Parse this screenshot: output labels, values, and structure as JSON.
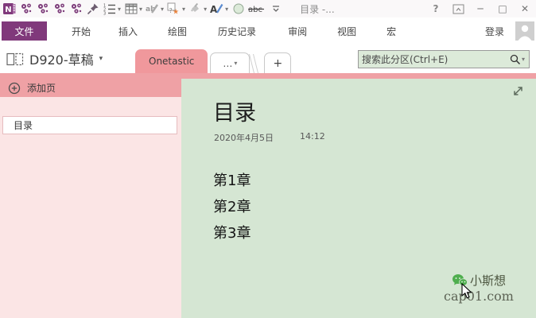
{
  "titlebar": {
    "title": "目录 -...",
    "help": "?",
    "spelling_letters": "ab",
    "strikethrough_label": "abc",
    "minimize": "─",
    "maximize": "□",
    "close": "✕",
    "quick_access_icons": [
      "onenote-logo",
      "macro-1",
      "macro-2",
      "macro-3",
      "macro-4",
      "pin",
      "numbered-list",
      "table",
      "spelling",
      "tag-star",
      "paint-bucket",
      "font-color",
      "green-circle",
      "strikethrough",
      "customize-toolbar"
    ]
  },
  "ribbon": {
    "tabs": [
      {
        "label": "文件",
        "active": true
      },
      {
        "label": "开始",
        "active": false
      },
      {
        "label": "插入",
        "active": false
      },
      {
        "label": "绘图",
        "active": false
      },
      {
        "label": "历史记录",
        "active": false
      },
      {
        "label": "审阅",
        "active": false
      },
      {
        "label": "视图",
        "active": false
      },
      {
        "label": "宏",
        "active": false
      }
    ],
    "sign_in_label": "登录"
  },
  "nav": {
    "notebook_label": "D920-草稿",
    "notebook_caret": "▾",
    "section_tabs": [
      {
        "label": "Onetastic",
        "active": true
      },
      {
        "label": "…",
        "active": false
      }
    ],
    "section_dots_caret": "▾",
    "new_section_label": "+",
    "search_placeholder": "搜索此分区(Ctrl+E)",
    "search_caret": "▾"
  },
  "sidebar": {
    "add_page_label": "添加页",
    "pages": [
      {
        "title": "目录",
        "selected": true
      }
    ]
  },
  "page": {
    "title": "目录",
    "date": "2020年4月5日",
    "time": "14:12",
    "lines": [
      "第1章",
      "第2章",
      "第3章"
    ]
  },
  "watermark": {
    "name": "小斯想",
    "site": "cap01.com"
  },
  "colors": {
    "accent_purple": "#80397B",
    "section_tab_pink": "#F0989C",
    "strip_pink": "#EFA1A5",
    "sidebar_pink": "#FBE5E5",
    "page_green": "#D5E6D3",
    "search_green": "#DCEAD9",
    "wechat_green": "#4FAE4E"
  }
}
